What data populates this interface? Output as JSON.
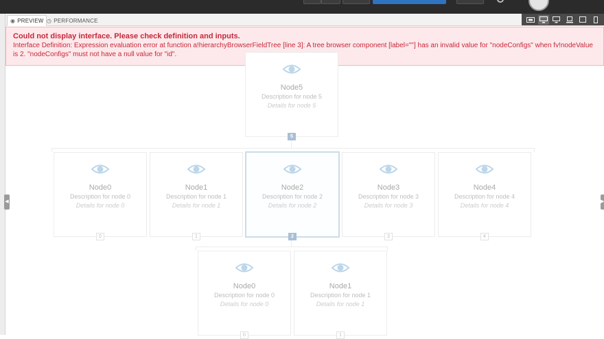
{
  "tabs": [
    {
      "label": "PREVIEW",
      "icon": "eye-icon",
      "active": true
    },
    {
      "label": "PERFORMANCE",
      "icon": "clock-icon",
      "active": false
    }
  ],
  "device_icons": [
    "fit-icon",
    "desktop-icon",
    "monitor-icon",
    "laptop-icon",
    "tablet-landscape-icon",
    "phone-icon"
  ],
  "error": {
    "heading": "Could not display interface. Please check definition and inputs.",
    "message": "Interface Definition: Expression evaluation error at function a!hierarchyBrowserFieldTree [line 3]: A tree browser component [label=\"\"] has an invalid value for \"nodeConfigs\" when fv!nodeValue is 2. \"nodeConfigs\" must not have a null value for \"id\"."
  },
  "tree": {
    "root": {
      "title": "Node5",
      "description": "Description for node 5",
      "details": "Details for node 5",
      "badge": "5",
      "selected": true
    },
    "level1": [
      {
        "title": "Node0",
        "description": "Description for node 0",
        "details": "Details for node 0",
        "badge": "0",
        "selected": false
      },
      {
        "title": "Node1",
        "description": "Description for node 1",
        "details": "Details for node 1",
        "badge": "1",
        "selected": false
      },
      {
        "title": "Node2",
        "description": "Description for node 2",
        "details": "Details for node 2",
        "badge": "2",
        "selected": true
      },
      {
        "title": "Node3",
        "description": "Description for node 3",
        "details": "Details for node 3",
        "badge": "3",
        "selected": false
      },
      {
        "title": "Node4",
        "description": "Description for node 4",
        "details": "Details for node 4",
        "badge": "4",
        "selected": false
      }
    ],
    "level2": [
      {
        "title": "Node0",
        "description": "Description for node 0",
        "details": "Details for node 0",
        "badge": "0",
        "selected": false
      },
      {
        "title": "Node1",
        "description": "Description for node 1",
        "details": "Details for node 1",
        "badge": "1",
        "selected": false
      }
    ]
  },
  "colors": {
    "error_text": "#c4283a",
    "error_bg": "#fde9eb",
    "selected_border": "#cbdce9",
    "badge_active": "#a9bfd4",
    "eye": "#bcd6ea"
  }
}
